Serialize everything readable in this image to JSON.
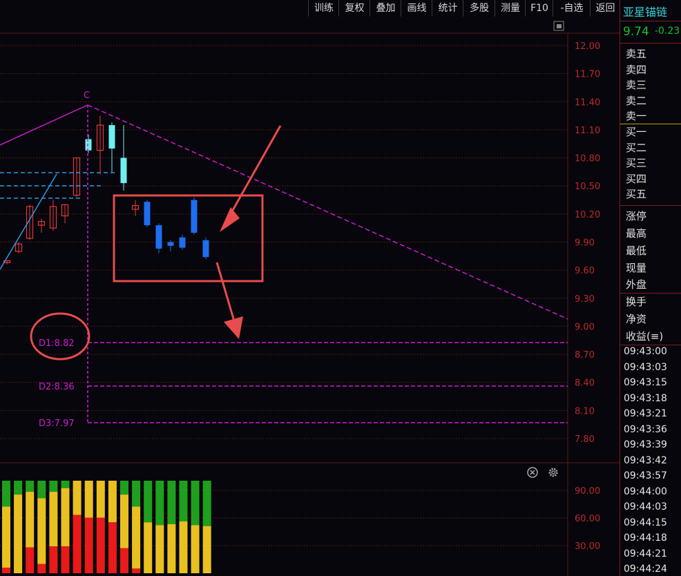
{
  "toolbar": [
    "训练",
    "复权",
    "叠加",
    "画线",
    "统计",
    "多股",
    "测量",
    "F10",
    "-自选",
    "返回"
  ],
  "stock": {
    "name": "亚星锚链",
    "price": "9.74",
    "change": "-0.23"
  },
  "orderbook": {
    "sell": [
      "卖五",
      "卖四",
      "卖三",
      "卖二",
      "卖一"
    ],
    "buy": [
      "买一",
      "买二",
      "买三",
      "买四",
      "买五"
    ]
  },
  "stats": [
    "涨停",
    "最高",
    "最低",
    "现量",
    "外盘",
    "换手",
    "净资",
    "收益(≡)"
  ],
  "times": [
    "09:43:00",
    "09:43:03",
    "09:43:15",
    "09:43:18",
    "09:43:21",
    "09:43:36",
    "09:43:39",
    "09:43:42",
    "09:43:57",
    "09:44:00",
    "09:44:03",
    "09:44:15",
    "09:44:18",
    "09:44:21",
    "09:44:24"
  ],
  "price_axis": [
    "12.00",
    "11.70",
    "11.40",
    "11.10",
    "10.80",
    "10.50",
    "10.20",
    "9.90",
    "9.60",
    "9.30",
    "9.00",
    "8.70",
    "8.40",
    "8.10",
    "7.80"
  ],
  "indicator_axis": [
    "90.00",
    "60.00",
    "30.00"
  ],
  "annotations": {
    "peak": "C",
    "d1": "D1:8.82",
    "d2": "D2:8.36",
    "d3": "D3:7.97"
  },
  "colors": {
    "bg": "#06060c",
    "up": "#e8383a",
    "down_cyan": "#6ff0f0",
    "down_blue": "#1e6ef0",
    "grid": "#5a1a1a",
    "magenta": "#d21bd2",
    "annot_red": "#e84c4c",
    "dash_blue": "#2a9ae8"
  },
  "chart_data": {
    "type": "candlestick",
    "candles": [
      {
        "o": 9.68,
        "h": 9.7,
        "l": 9.66,
        "c": 9.7
      },
      {
        "o": 9.8,
        "h": 9.9,
        "l": 9.78,
        "c": 9.88
      },
      {
        "o": 9.94,
        "h": 10.3,
        "l": 9.92,
        "c": 10.28
      },
      {
        "o": 10.08,
        "h": 10.15,
        "l": 10.0,
        "c": 10.12
      },
      {
        "o": 10.05,
        "h": 10.35,
        "l": 10.02,
        "c": 10.28
      },
      {
        "o": 10.18,
        "h": 10.3,
        "l": 10.1,
        "c": 10.3
      },
      {
        "o": 10.4,
        "h": 10.8,
        "l": 10.38,
        "c": 10.8
      },
      {
        "o": 11.0,
        "h": 11.05,
        "l": 10.85,
        "c": 10.88
      },
      {
        "o": 10.88,
        "h": 11.25,
        "l": 10.62,
        "c": 11.15
      },
      {
        "o": 11.15,
        "h": 11.18,
        "l": 10.65,
        "c": 10.9
      },
      {
        "o": 10.8,
        "h": 11.15,
        "l": 10.45,
        "c": 10.53
      },
      {
        "o": 10.25,
        "h": 10.35,
        "l": 10.18,
        "c": 10.29
      },
      {
        "o": 10.33,
        "h": 10.35,
        "l": 10.06,
        "c": 10.08
      },
      {
        "o": 10.08,
        "h": 10.1,
        "l": 9.78,
        "c": 9.83
      },
      {
        "o": 9.9,
        "h": 9.92,
        "l": 9.8,
        "c": 9.86
      },
      {
        "o": 9.95,
        "h": 9.98,
        "l": 9.82,
        "c": 9.84
      },
      {
        "o": 10.35,
        "h": 10.38,
        "l": 9.98,
        "c": 10.0
      },
      {
        "o": 9.92,
        "h": 9.95,
        "l": 9.72,
        "c": 9.74
      }
    ],
    "indicator": [
      {
        "top": 0.72,
        "mid": 0.06
      },
      {
        "top": 0.85,
        "mid": 0.0
      },
      {
        "top": 0.88,
        "mid": 0.28
      },
      {
        "top": 0.81,
        "mid": 0.1
      },
      {
        "top": 0.88,
        "mid": 0.29
      },
      {
        "top": 0.92,
        "mid": 0.29
      },
      {
        "top": 0.0,
        "mid": 0.63
      },
      {
        "top": 0.0,
        "mid": 0.6
      },
      {
        "top": 0.0,
        "mid": 0.6
      },
      {
        "top": 0.0,
        "mid": 0.55
      },
      {
        "top": 0.85,
        "mid": 0.27
      },
      {
        "top": 0.72,
        "mid": 0.05
      },
      {
        "top": 0.55,
        "mid": 0.0
      },
      {
        "top": 0.52,
        "mid": 0.0
      },
      {
        "top": 0.53,
        "mid": 0.0
      },
      {
        "top": 0.56,
        "mid": 0.0
      },
      {
        "top": 0.52,
        "mid": 0.0
      },
      {
        "top": 0.51,
        "mid": 0.0
      }
    ]
  }
}
